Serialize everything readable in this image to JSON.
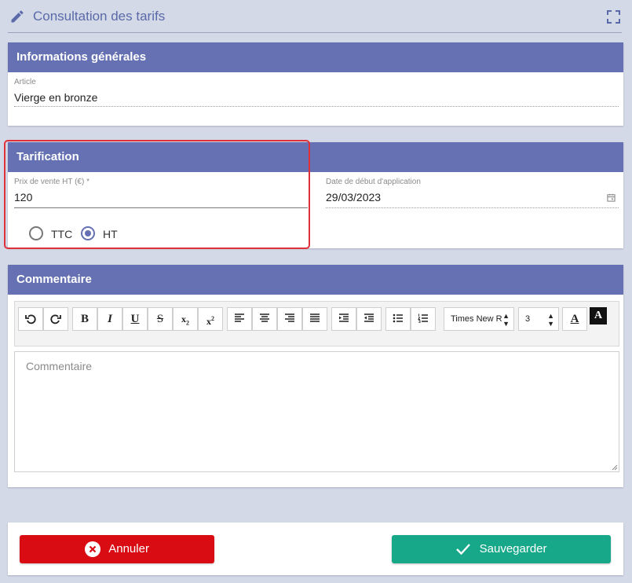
{
  "header": {
    "title": "Consultation des tarifs",
    "edit_icon": "pencil-icon",
    "expand_icon": "expand-icon"
  },
  "info": {
    "heading": "Informations générales",
    "article_label": "Article",
    "article_value": "Vierge en bronze"
  },
  "pricing": {
    "heading": "Tarification",
    "price_label": "Prix de vente HT (€) *",
    "price_value": "120",
    "date_label": "Date de début d'application",
    "date_value": "29/03/2023",
    "radio_ttc": "TTC",
    "radio_ht": "HT",
    "selected": "HT"
  },
  "comment": {
    "heading": "Commentaire",
    "placeholder": "Commentaire",
    "font_family": "Times New R",
    "font_size": "3"
  },
  "footer": {
    "cancel_label": "Annuler",
    "save_label": "Sauvegarder"
  },
  "colors": {
    "header": "#6571b2",
    "cancel": "#d90c14",
    "save": "#17a88a",
    "accent": "#5a6aa8"
  }
}
